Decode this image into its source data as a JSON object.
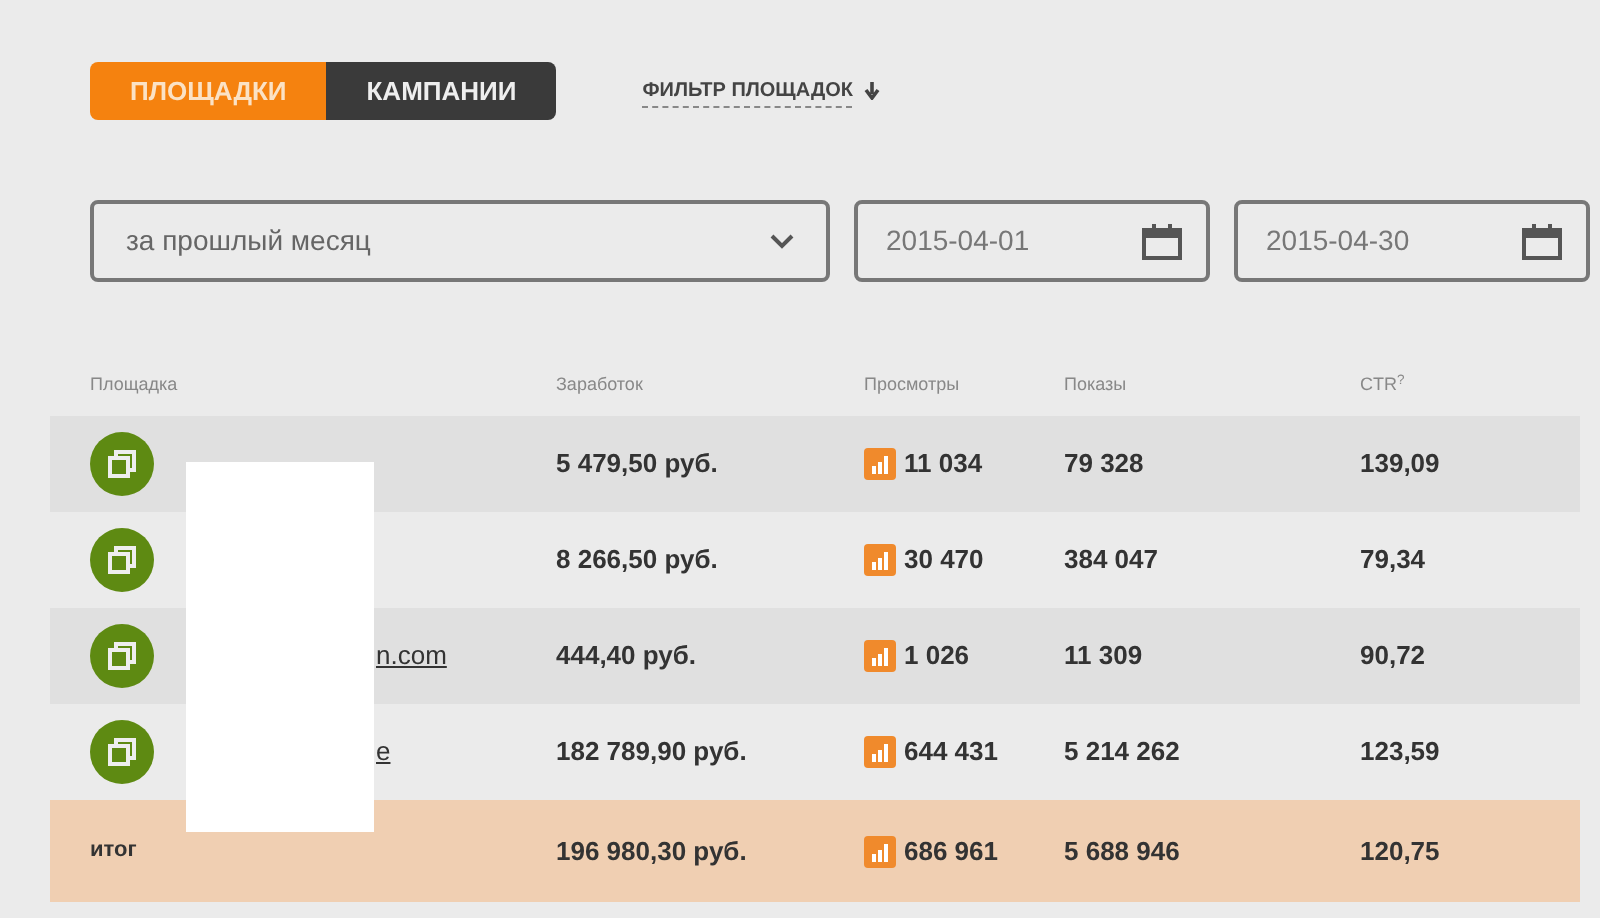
{
  "tabs": [
    {
      "label": "ПЛОЩАДКИ",
      "selected": true
    },
    {
      "label": "КАМПАНИИ",
      "selected": false
    }
  ],
  "filter_link": {
    "label": "ФИЛЬТР ПЛОЩАДОК",
    "expanded": false
  },
  "period_select": {
    "value": "за прошлый месяц"
  },
  "date_from": {
    "value": "2015-04-01"
  },
  "date_to": {
    "value": "2015-04-30"
  },
  "table": {
    "columns": [
      "Площадка",
      "Заработок",
      "Просмотры",
      "Показы",
      "CTR$^{?}$"
    ],
    "rows": [
      {
        "site": "",
        "earnings": "5 479,50 руб.",
        "views": "11 034",
        "shows": "79 328",
        "ctr": "139,09"
      },
      {
        "site": "",
        "earnings": "8 266,50 руб.",
        "views": "30 470",
        "shows": "384 047",
        "ctr": "79,34"
      },
      {
        "site": "n.com",
        "earnings": "444,40 руб.",
        "views": "1 026",
        "shows": "11 309",
        "ctr": "90,72"
      },
      {
        "site": "e",
        "earnings": "182 789,90 руб.",
        "views": "644 431",
        "shows": "5 214 262",
        "ctr": "123,59"
      }
    ],
    "total": {
      "label": "итог",
      "earnings": "196 980,30 руб.",
      "views": "686 961",
      "shows": "5 688 946",
      "ctr": "120,75"
    }
  }
}
